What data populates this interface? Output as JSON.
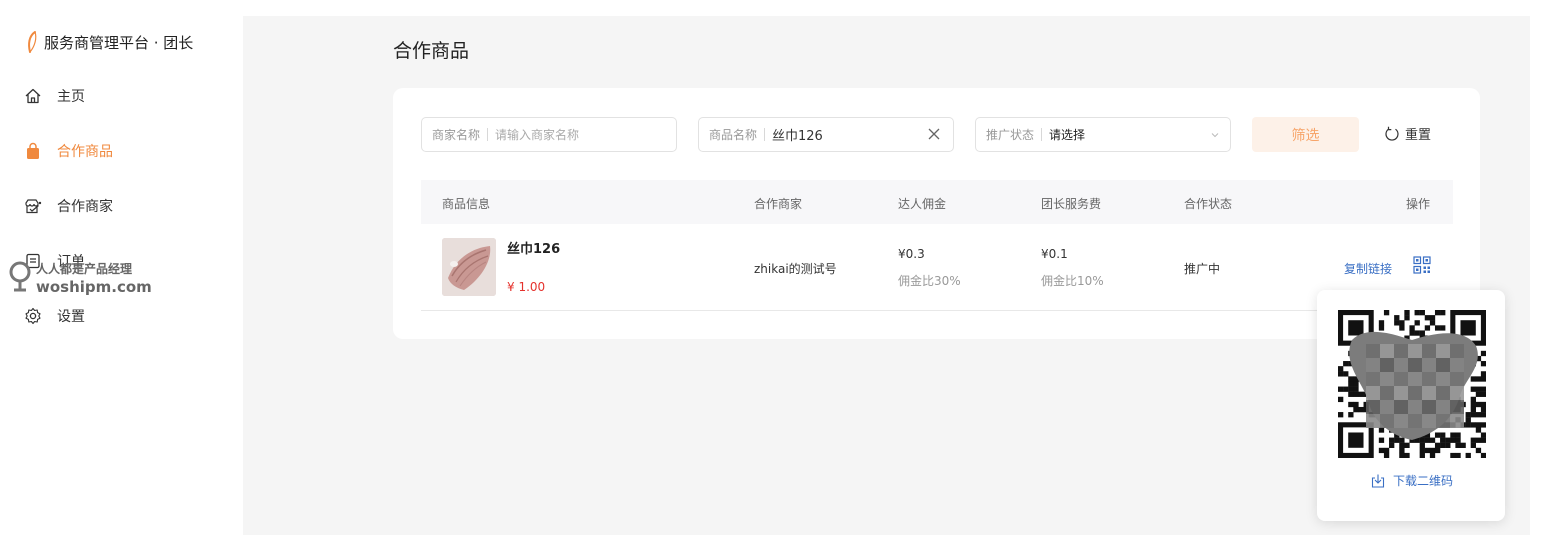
{
  "brand": {
    "title": "服务商管理平台 · 团长",
    "accent": "#f0893e"
  },
  "sidebar": {
    "items": [
      {
        "label": "主页",
        "icon": "home-icon",
        "active": false
      },
      {
        "label": "合作商品",
        "icon": "bag-icon",
        "active": true
      },
      {
        "label": "合作商家",
        "icon": "merchant-icon",
        "active": false
      },
      {
        "label": "订单",
        "icon": "order-icon",
        "active": false
      },
      {
        "label": "设置",
        "icon": "gear-icon",
        "active": false
      }
    ]
  },
  "watermark": {
    "line1": "人人都是产品经理",
    "line2": "woshipm.com"
  },
  "page": {
    "title": "合作商品"
  },
  "filters": {
    "merchant": {
      "label": "商家名称",
      "placeholder": "请输入商家名称"
    },
    "product": {
      "label": "商品名称",
      "value": "丝巾126"
    },
    "status": {
      "label": "推广状态",
      "value": "请选择"
    },
    "filter_button": "筛选",
    "reset_button": "重置"
  },
  "table": {
    "columns": [
      "商品信息",
      "合作商家",
      "达人佣金",
      "团长服务费",
      "合作状态",
      "操作"
    ],
    "rows": [
      {
        "name": "丝巾126",
        "price": "¥ 1.00",
        "merchant": "zhikai的测试号",
        "commission": "¥0.3",
        "commission_rate": "佣金比30%",
        "service_fee": "¥0.1",
        "service_rate": "佣金比10%",
        "status": "推广中",
        "action_copy": "复制链接",
        "action_qr_icon": "qrcode-icon"
      }
    ]
  },
  "qr_popover": {
    "download_label": "下载二维码"
  }
}
